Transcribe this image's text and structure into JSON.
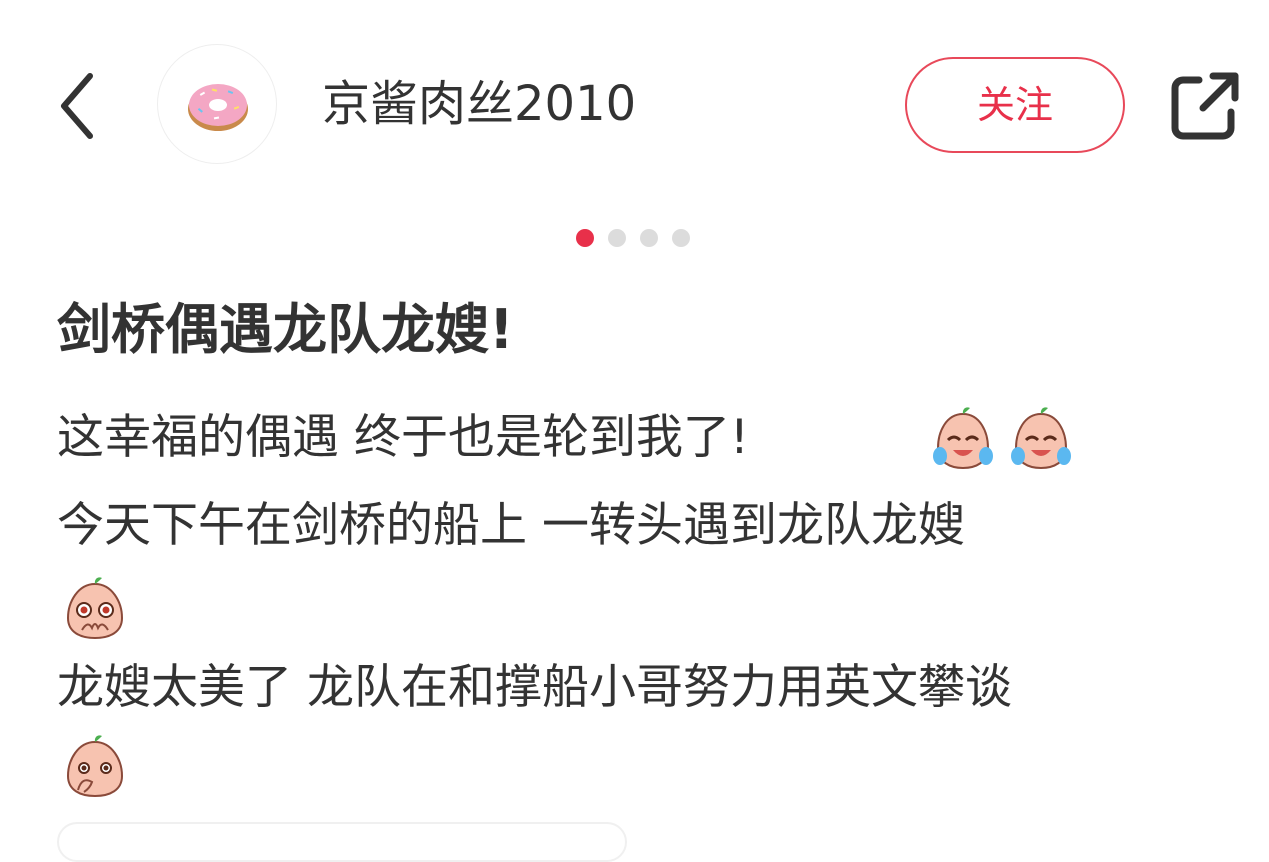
{
  "header": {
    "username": "京酱肉丝2010",
    "follow_label": "关注",
    "back_icon": "chevron-left-icon",
    "share_icon": "share-icon",
    "avatar_icon": "donut-icon"
  },
  "carousel": {
    "total": 4,
    "active_index": 0
  },
  "post": {
    "title": "剑桥偶遇龙队龙嫂!",
    "line1": "这幸福的偶遇  终于也是轮到我了!",
    "line2": "今天下午在剑桥的船上  一转头遇到龙队龙嫂",
    "line3": "龙嫂太美了  龙队在和撑船小哥努力用英文攀谈",
    "emojis": [
      "laughing-tears-emoji",
      "laughing-tears-emoji",
      "pleading-emoji",
      "covering-mouth-emoji"
    ]
  },
  "colors": {
    "accent": "#e8304a",
    "text": "#333333",
    "dot_inactive": "#dcdcdc"
  }
}
